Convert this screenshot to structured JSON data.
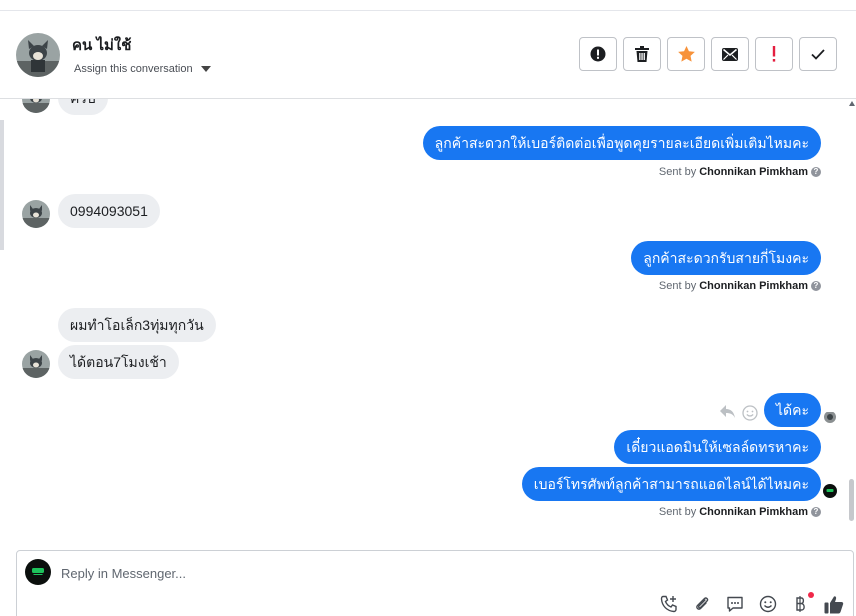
{
  "header": {
    "contact_name": "คน ไม่ใช้",
    "assign_label": "Assign this conversation",
    "actions": [
      {
        "name": "mark-spam-button",
        "icon": "alert-circle-icon"
      },
      {
        "name": "delete-button",
        "icon": "trash-icon"
      },
      {
        "name": "star-button",
        "icon": "star-icon"
      },
      {
        "name": "mark-unread-button",
        "icon": "envelope-icon"
      },
      {
        "name": "follow-up-button",
        "icon": "exclamation-icon"
      },
      {
        "name": "mark-done-button",
        "icon": "check-icon"
      }
    ]
  },
  "messages": {
    "m0": "ครับ",
    "m1": "ลูกค้าสะดวกให้เบอร์ติดต่อเพื่อพูดคุยรายละเอียดเพิ่มเติมไหมคะ",
    "m2": "0994093051",
    "m3": "ลูกค้าสะดวกรับสายกี่โมงคะ",
    "m4": "ผมทำโอเล็ก3ทุ่มทุกวัน",
    "m5": "ได้ตอน7โมงเช้า",
    "m6": "ได้คะ",
    "m7": "เดี๋ยวแอดมินให้เซลล์ดทรหาคะ",
    "m8": "เบอร์โทรศัพท์ลูกค้าสามารถแอดไลน์ได้ไหมคะ"
  },
  "sent_by": {
    "prefix": "Sent by",
    "agent": "Chonnikan Pimkham"
  },
  "reply": {
    "placeholder": "Reply in Messenger..."
  },
  "colors": {
    "outgoing": "#1877f2",
    "incoming": "#eceef1",
    "star": "#f7923a",
    "follow_up": "#e41e3f"
  }
}
